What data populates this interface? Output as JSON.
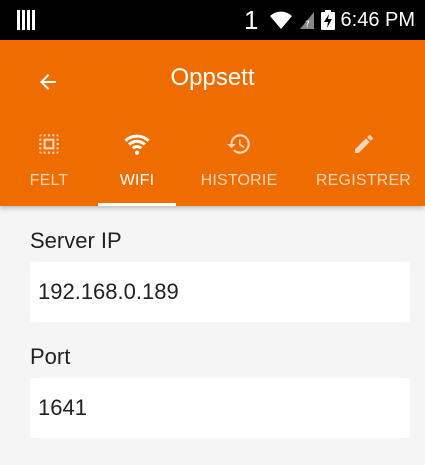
{
  "status_bar": {
    "notification_count": "1",
    "time": "6:46 PM",
    "icons": [
      "barcode-icon",
      "wifi-icon",
      "signal-icon",
      "battery-icon"
    ]
  },
  "app_bar": {
    "title": "Oppsett",
    "back_icon": "arrow-left-icon",
    "background_color": "#ef6c00"
  },
  "tabs": [
    {
      "label": "FELT",
      "icon": "select-all-icon",
      "active": false
    },
    {
      "label": "WIFI",
      "icon": "wifi-icon",
      "active": true
    },
    {
      "label": "HISTORIE",
      "icon": "history-icon",
      "active": false
    },
    {
      "label": "REGISTRER",
      "icon": "pencil-icon",
      "active": false
    }
  ],
  "form": {
    "server_ip": {
      "label": "Server IP",
      "value": "192.168.0.189"
    },
    "port": {
      "label": "Port",
      "value": "1641"
    }
  }
}
